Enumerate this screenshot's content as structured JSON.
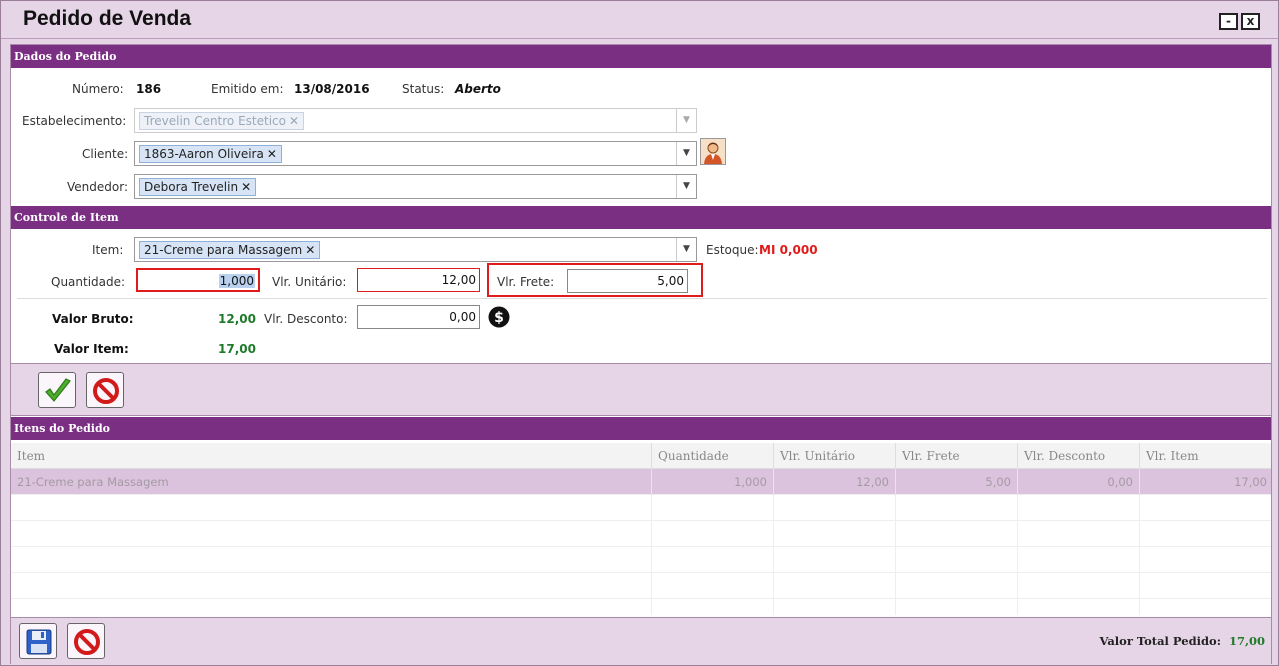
{
  "window": {
    "title": "Pedido de Venda",
    "minimize": "-",
    "close": "x"
  },
  "dados": {
    "header": "Dados do Pedido",
    "numero_label": "Número:",
    "numero_value": "186",
    "emitido_label": "Emitido em:",
    "emitido_value": "13/08/2016",
    "status_label": "Status:",
    "status_value": "Aberto",
    "estabelecimento_label": "Estabelecimento:",
    "estabelecimento_value": "Trevelin Centro Estetico",
    "cliente_label": "Cliente:",
    "cliente_value": "1863-Aaron Oliveira",
    "vendedor_label": "Vendedor:",
    "vendedor_value": "Debora Trevelin"
  },
  "controle": {
    "header": "Controle de Item",
    "item_label": "Item:",
    "item_value": "21-Creme para Massagem",
    "estoque_label": "Estoque:",
    "estoque_value": "MI 0,000",
    "quantidade_label": "Quantidade:",
    "quantidade_value": "1,000",
    "unitario_label": "Vlr. Unitário:",
    "unitario_value": "12,00",
    "frete_label": "Vlr. Frete:",
    "frete_value": "5,00",
    "bruto_label": "Valor Bruto:",
    "bruto_value": "12,00",
    "desconto_label": "Vlr. Desconto:",
    "desconto_value": "0,00",
    "item_total_label": "Valor Item:",
    "item_total_value": "17,00"
  },
  "itens": {
    "header": "Itens do Pedido",
    "columns": [
      "Item",
      "Quantidade",
      "Vlr. Unitário",
      "Vlr. Frete",
      "Vlr. Desconto",
      "Vlr. Item"
    ],
    "rows": [
      [
        "21-Creme para Massagem",
        "1,000",
        "12,00",
        "5,00",
        "0,00",
        "17,00"
      ]
    ]
  },
  "footer": {
    "total_label": "Valor Total Pedido:",
    "total_value": "17,00"
  },
  "icons": {
    "confirm": "check-icon",
    "cancel": "prohibited-icon",
    "save": "floppy-disk-icon",
    "client_lookup": "person-icon",
    "discount": "dollar-icon"
  },
  "colors": {
    "section_header": "#7a2f83",
    "highlight_border": "#e01b1b",
    "value_green": "#1f7a2a",
    "estoque_red": "#e01b1b"
  }
}
